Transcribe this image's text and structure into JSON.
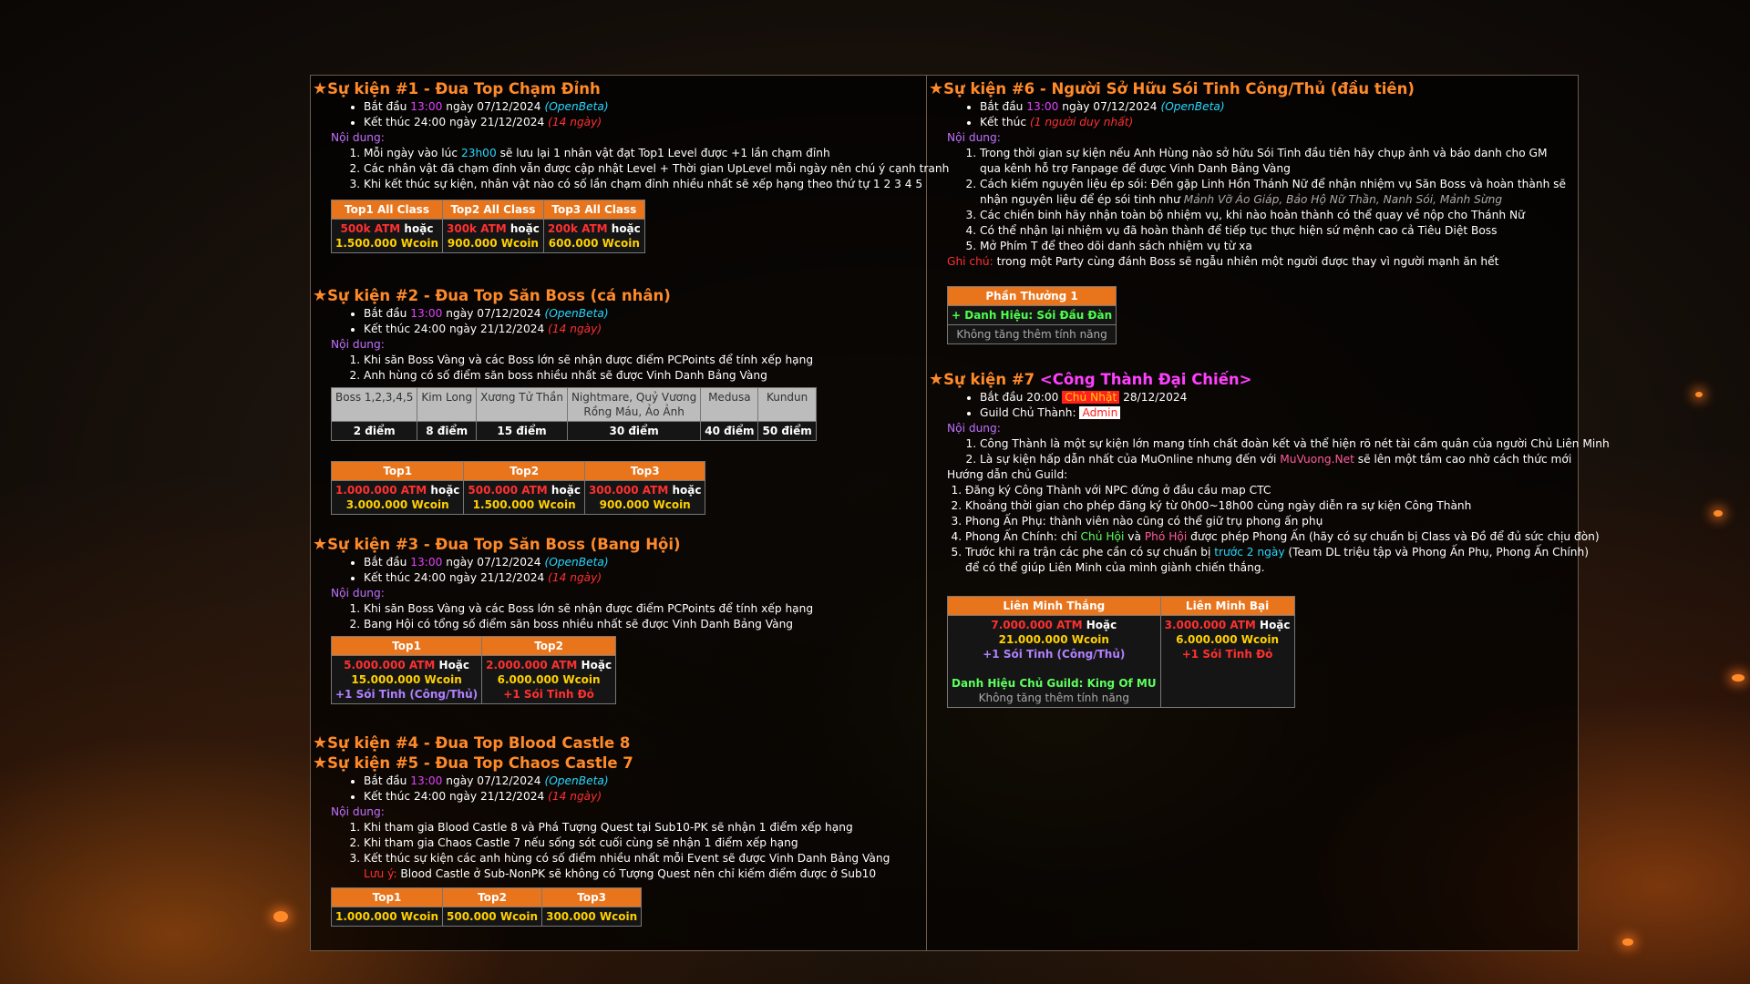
{
  "left": {
    "ev1": {
      "title": "Sự kiện #1 - Đua Top Chạm Đỉnh",
      "start_prefix": "Bắt đầu ",
      "start_time": "13:00",
      "start_date": " ngày 07/12/2024 ",
      "start_tag": "(OpenBeta)",
      "end_text": "Kết thúc 24:00 ngày 21/12/2024 ",
      "end_tag": "(14 ngày)",
      "content_label": "Nội dung:",
      "items": [
        {
          "pre": "Mỗi ngày vào lúc ",
          "hl": "23h00",
          "post": " sẽ lưu lại 1 nhân vật đạt Top1 Level được +1 lần chạm đỉnh"
        },
        {
          "pre": "Các nhân vật đã chạm đỉnh vẫn được cập nhật Level + Thời gian UpLevel mỗi ngày nên chú ý cạnh tranh",
          "hl": "",
          "post": ""
        },
        {
          "pre": "Khi kết thúc sự kiện, nhân vật nào có số lần chạm đỉnh nhiều nhất sẽ xếp hạng theo thứ tự 1 2 3 4 5",
          "hl": "",
          "post": ""
        }
      ],
      "table": {
        "headers": [
          "Top1 All Class",
          "Top2 All Class",
          "Top3 All Class"
        ],
        "atm": [
          "500k ATM",
          "300k ATM",
          "200k ATM"
        ],
        "or": " hoặc",
        "wcoin": [
          "1.500.000 Wcoin",
          "900.000 Wcoin",
          "600.000 Wcoin"
        ]
      }
    },
    "ev2": {
      "title": "Sự kiện #2 - Đua Top Săn Boss (cá nhân)",
      "start_prefix": "Bắt đầu ",
      "start_time": "13:00",
      "start_date": " ngày 07/12/2024 ",
      "start_tag": "(OpenBeta)",
      "end_text": "Kết thúc 24:00 ngày 21/12/2024 ",
      "end_tag": "(14 ngày)",
      "content_label": "Nội dung:",
      "items": [
        "Khi săn Boss Vàng và các Boss lớn sẽ nhận được điểm PCPoints để tính xếp hạng",
        "Anh hùng có số điểm săn boss nhiều nhất sẽ được Vinh Danh Bảng Vàng"
      ],
      "points_table": {
        "headers": [
          "Boss 1,2,3,4,5",
          "Kim Long",
          "Xương Tử Thần",
          "Nightmare, Quỷ Vương",
          "Medusa",
          "Kundun"
        ],
        "header_line2": "Rồng Máu, Ảo Ảnh",
        "values": [
          "2 điểm",
          "8 điểm",
          "15 điểm",
          "30 điểm",
          "40 điểm",
          "50 điểm"
        ]
      },
      "reward_table": {
        "headers": [
          "Top1",
          "Top2",
          "Top3"
        ],
        "atm": [
          "1.000.000 ATM",
          "500.000 ATM",
          "300.000 ATM"
        ],
        "or": " hoặc",
        "wcoin": [
          "3.000.000 Wcoin",
          "1.500.000 Wcoin",
          "900.000 Wcoin"
        ]
      }
    },
    "ev3": {
      "title": "Sự kiện #3 - Đua Top Săn Boss (Bang Hội)",
      "start_prefix": "Bắt đầu ",
      "start_time": "13:00",
      "start_date": " ngày 07/12/2024 ",
      "start_tag": "(OpenBeta)",
      "end_text": "Kết thúc 24:00 ngày 21/12/2024 ",
      "end_tag": "(14 ngày)",
      "content_label": "Nội dung:",
      "items": [
        "Khi săn Boss Vàng và các Boss lớn sẽ nhận được điểm PCPoints để tính xếp hạng",
        "Bang Hội có tổng số điểm săn boss nhiều nhất sẽ được Vinh Danh Bảng Vàng"
      ],
      "table": {
        "headers": [
          "Top1",
          "Top2"
        ],
        "atm": [
          "5.000.000 ATM",
          "2.000.000 ATM"
        ],
        "or": " Hoặc",
        "wcoin": [
          "15.000.000 Wcoin",
          "6.000.000 Wcoin"
        ],
        "extra": [
          "+1 Sói Tinh (Công/Thủ)",
          "+1 Sói Tinh Đỏ"
        ]
      }
    },
    "ev4": {
      "title": "Sự kiện #4 - Đua Top Blood Castle 8"
    },
    "ev5": {
      "title": "Sự kiện #5 - Đua Top Chaos Castle 7",
      "start_prefix": "Bắt đầu ",
      "start_time": "13:00",
      "start_date": " ngày 07/12/2024 ",
      "start_tag": "(OpenBeta)",
      "end_text": "Kết thúc 24:00 ngày 21/12/2024 ",
      "end_tag": "(14 ngày)",
      "content_label": "Nội dung:",
      "items": [
        "Khi tham gia Blood Castle 8 và Phá Tượng Quest tại Sub10-PK sẽ nhận 1 điểm xếp hạng",
        "Khi tham gia Chaos Castle 7 nếu sống sót cuối cùng sẽ nhận 1 điểm xếp hạng",
        "Kết thúc sự kiện các anh hùng có số điểm nhiều nhất mỗi Event sẽ được Vinh Danh Bảng Vàng"
      ],
      "note_label": "Lưu ý: ",
      "note_text": "Blood Castle ở Sub-NonPK sẽ không có Tượng Quest nên chỉ kiếm điểm được ở Sub10",
      "table": {
        "headers": [
          "Top1",
          "Top2",
          "Top3"
        ],
        "wcoin": [
          "1.000.000 Wcoin",
          "500.000 Wcoin",
          "300.000 Wcoin"
        ]
      }
    }
  },
  "right": {
    "ev6": {
      "title": "Sự kiện #6 - Người Sở Hữu Sói Tinh Công/Thủ (đầu tiên)",
      "start_prefix": "Bắt đầu ",
      "start_time": "13:00",
      "start_date": " ngày 07/12/2024 ",
      "start_tag": "(OpenBeta)",
      "end_text": "Kết thúc ",
      "end_tag": "(1 người duy nhất)",
      "content_label": "Nội dung:",
      "item1_a": "Trong thời gian sự kiện nếu Anh Hùng nào sở hữu Sói Tinh đầu tiên hãy chụp ảnh và báo danh cho GM",
      "item1_b": "qua kênh hỗ trợ Fanpage để được Vinh Danh Bảng Vàng",
      "item2_a": "Cách kiếm nguyên liệu ép sói: Đến gặp Linh Hồn Thánh Nữ để nhận nhiệm vụ Săn Boss và hoàn thành sẽ",
      "item2_b": "nhận nguyên liệu để ép sói tinh như ",
      "item2_c": "Mảnh Vỡ Áo Giáp, Bảo Hộ Nữ Thần, Nanh Sói, Mảnh Sừng",
      "item3": "Các chiến binh hãy nhận toàn bộ nhiệm vụ, khi nào hoàn thành có thể quay về nộp cho Thánh Nữ",
      "item4": "Có thể nhận lại nhiệm vụ đã hoàn thành để tiếp tục thực hiện sứ mệnh cao cả Tiêu Diệt Boss",
      "item5": "Mở Phím T để theo dõi danh sách nhiệm vụ từ xa",
      "note_label": "Ghi chú: ",
      "note_text": "trong một Party cùng đánh Boss sẽ ngẫu nhiên một người được thay vì người mạnh ăn hết",
      "table": {
        "header": "Phần Thưởng 1",
        "reward": "+ Danh Hiệu: Sói Đầu Đàn",
        "note": "Không tăng thêm tính năng"
      }
    },
    "ev7": {
      "title_a": "Sự kiện #7 ",
      "title_b": "<Công Thành Đại Chiến>",
      "start_prefix": "Bắt đầu 20:00 ",
      "start_day": "Chủ Nhật",
      "start_date": " 28/12/2024",
      "guild_label": "Guild Chủ Thành: ",
      "guild_name": "Admin",
      "content_label": "Nội dung:",
      "c1": "Công Thành là một sự kiện lớn mang tính chất đoàn kết và thể hiện rõ nét tài cầm quân của người Chủ Liên Minh",
      "c2_a": "Là sự kiện hấp dẫn nhất của MuOnline nhưng đến với ",
      "c2_b": "MuVuong.Net",
      "c2_c": " sẽ lên một tầm cao nhờ cách thức mới",
      "guide_label": "Hướng dẫn chủ Guild:",
      "g1": "Đăng ký Công Thành với NPC đứng ở đầu cầu map CTC",
      "g2": "Khoảng thời gian cho phép đăng ký từ 0h00~18h00 cùng ngày diễn ra sự kiện Công Thành",
      "g3": "Phong Ấn Phụ: thành viên nào cũng có thể giữ trụ phong ấn phụ",
      "g4_a": "Phong Ấn Chính: chỉ ",
      "g4_b": "Chủ Hội",
      "g4_c": " và ",
      "g4_d": "Phó Hội",
      "g4_e": " được phép Phong Ấn (hãy có sự chuẩn bị Class và Đồ để đủ sức chịu đòn)",
      "g5_a": "Trước khi ra trận các phe cần có sự chuẩn bị ",
      "g5_b": "trước 2 ngày",
      "g5_c": " (Team DL triệu tập và Phong Ấn Phụ, Phong Ấn Chính)",
      "g5_d": "để có thể giúp Liên Minh của mình giành chiến thắng.",
      "table": {
        "headers": [
          "Liên Minh Thắng",
          "Liên Minh Bại"
        ],
        "atm": [
          "7.000.000 ATM",
          "3.000.000 ATM"
        ],
        "or": " Hoặc",
        "wcoin": [
          "21.000.000 Wcoin",
          "6.000.000 Wcoin"
        ],
        "extra": [
          "+1 Sói Tinh (Công/Thủ)",
          "+1 Sói Tinh Đỏ"
        ],
        "title_reward": "Danh Hiệu Chủ Guild: King Of MU",
        "note": "Không tăng thêm tính năng"
      }
    }
  }
}
